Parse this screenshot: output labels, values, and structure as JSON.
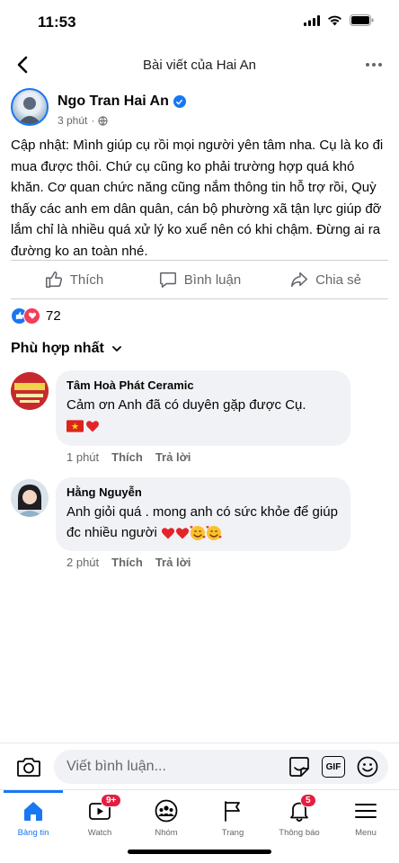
{
  "status_bar": {
    "time": "11:53"
  },
  "header": {
    "title": "Bài viết của Hai An"
  },
  "post": {
    "author": "Ngo Tran Hai An",
    "time": "3 phút",
    "text": "Cập nhật:  Mình giúp cụ rồi mọi người yên tâm nha. Cụ là ko đi mua được thôi. Chứ cụ cũng ko phải trường hợp quá khó khăn. Cơ quan chức năng cũng nắm thông tin hỗ trợ rồi, Quỳ thấy các anh em dân quân, cán bộ phường xã tận lực giúp đỡ lắm chỉ là nhiều quá xử lý ko xuể nên có khi chậm.  Đừng ai ra đường ko an toàn nhé.",
    "actions": {
      "like": "Thích",
      "comment": "Bình luận",
      "share": "Chia sẻ"
    },
    "reaction_count": "72"
  },
  "comments_sort": "Phù hợp nhất",
  "comments": [
    {
      "name": "Tâm Hoà Phát Ceramic",
      "text": "Cảm ơn Anh đã có duyên gặp được Cụ.",
      "time": "1 phút",
      "like": "Thích",
      "reply": "Trả lời"
    },
    {
      "name": "Hằng Nguyễn",
      "text": "Anh giỏi quá . mong anh có sức khỏe để giúp đc nhiều người",
      "time": "2 phút",
      "like": "Thích",
      "reply": "Trả lời"
    }
  ],
  "composer": {
    "placeholder": "Viết bình luận...",
    "gif": "GIF"
  },
  "tabs": [
    {
      "label": "Bảng tin",
      "icon": "home-icon",
      "badge": ""
    },
    {
      "label": "Watch",
      "icon": "watch-icon",
      "badge": "9+"
    },
    {
      "label": "Nhóm",
      "icon": "groups-icon",
      "badge": ""
    },
    {
      "label": "Trang",
      "icon": "flag-icon",
      "badge": ""
    },
    {
      "label": "Thông báo",
      "icon": "bell-icon",
      "badge": "5"
    },
    {
      "label": "Menu",
      "icon": "menu-icon",
      "badge": ""
    }
  ],
  "colors": {
    "accent": "#1877f2",
    "love": "#f33e58",
    "badge": "#e41e3f",
    "bubble": "#f0f2f5",
    "muted": "#65676b"
  }
}
